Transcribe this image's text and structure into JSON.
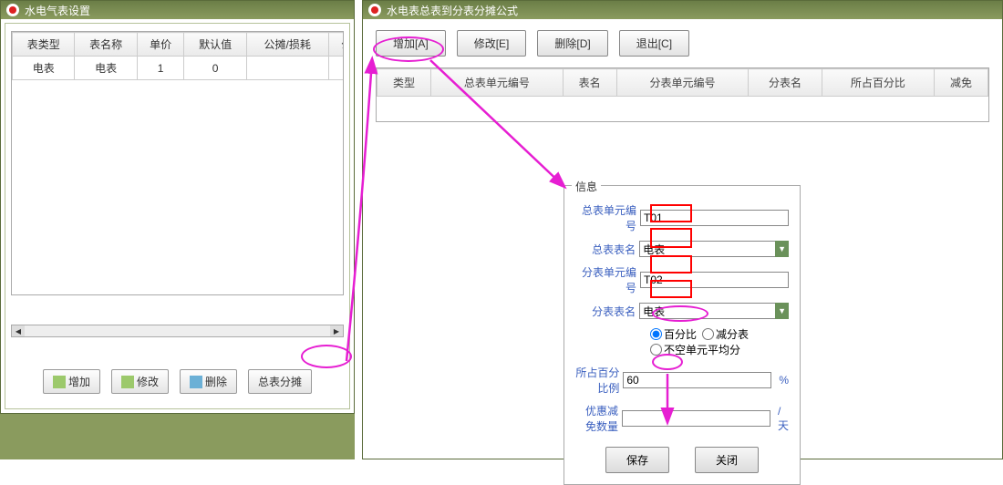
{
  "left": {
    "title": "水电气表设置",
    "headers": [
      "表类型",
      "表名称",
      "单价",
      "默认值",
      "公摊/损耗",
      "公摊"
    ],
    "row": {
      "type": "电表",
      "name": "电表",
      "price": "1",
      "def": "0",
      "share": "",
      "extra": ""
    },
    "btns": {
      "add": "增加",
      "edit": "修改",
      "del": "删除",
      "allocate": "总表分摊"
    }
  },
  "right": {
    "title": "水电表总表到分表分摊公式",
    "toolbar": {
      "add": "增加[A]",
      "edit": "修改[E]",
      "del": "删除[D]",
      "quit": "退出[C]"
    },
    "headers": [
      "类型",
      "总表单元编号",
      "表名",
      "分表单元编号",
      "分表名",
      "所占百分比",
      "减免"
    ]
  },
  "info": {
    "legend": "信息",
    "labels": {
      "mainUnit": "总表单元编号",
      "mainName": "总表表名",
      "subUnit": "分表单元编号",
      "subName": "分表表名",
      "pct": "所占百分比例",
      "free": "优惠减免数量"
    },
    "values": {
      "mainUnit": "T01",
      "mainName": "电表",
      "subUnit": "T02",
      "subName": "电表",
      "pct": "60",
      "free": ""
    },
    "radios": {
      "pct": "百分比",
      "sub": "减分表",
      "avg": "不空单元平均分"
    },
    "units": {
      "pct": "%",
      "free": "/天"
    },
    "btns": {
      "save": "保存",
      "close": "关闭"
    }
  }
}
